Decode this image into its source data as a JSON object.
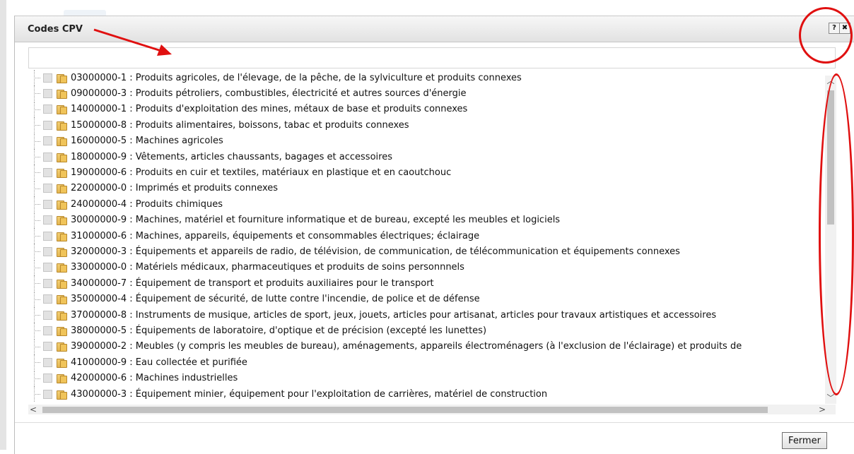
{
  "dialog": {
    "title": "Codes CPV",
    "help_label": "?",
    "close_label": "✖",
    "search": {
      "value": "",
      "placeholder": ""
    },
    "close_button_label": "Fermer"
  },
  "tree": {
    "items": [
      {
        "label": "03000000-1 : Produits agricoles, de l'élevage, de la pêche, de la sylviculture et produits connexes"
      },
      {
        "label": "09000000-3 : Produits pétroliers, combustibles, électricité et autres sources d'énergie"
      },
      {
        "label": "14000000-1 : Produits d'exploitation des mines, métaux de base et produits connexes"
      },
      {
        "label": "15000000-8 : Produits alimentaires, boissons, tabac et produits connexes"
      },
      {
        "label": "16000000-5 : Machines agricoles"
      },
      {
        "label": "18000000-9 : Vêtements, articles chaussants, bagages et accessoires"
      },
      {
        "label": "19000000-6 : Produits en cuir et textiles, matériaux en plastique et en caoutchouc"
      },
      {
        "label": "22000000-0 : Imprimés et produits connexes"
      },
      {
        "label": "24000000-4 : Produits chimiques"
      },
      {
        "label": "30000000-9 : Machines, matériel et fourniture informatique et de bureau, excepté les meubles et logiciels"
      },
      {
        "label": "31000000-6 : Machines, appareils, équipements et consommables électriques; éclairage"
      },
      {
        "label": "32000000-3 : Équipements et appareils de radio, de télévision, de communication, de télécommunication et équipements connexes"
      },
      {
        "label": "33000000-0 : Matériels médicaux, pharmaceutiques et produits de soins personnnels"
      },
      {
        "label": "34000000-7 : Équipement de transport et produits auxiliaires pour le transport"
      },
      {
        "label": "35000000-4 : Équipement de sécurité, de lutte contre l'incendie, de police et de défense"
      },
      {
        "label": "37000000-8 : Instruments de musique, articles de sport, jeux, jouets, articles pour artisanat, articles pour travaux artistiques et accessoires"
      },
      {
        "label": "38000000-5 : Équipements de laboratoire, d'optique et de précision (excepté les lunettes)"
      },
      {
        "label": "39000000-2 : Meubles (y compris les meubles de bureau), aménagements, appareils électroménagers (à l'exclusion de l'éclairage) et produits de"
      },
      {
        "label": "41000000-9 : Eau collectée et purifiée"
      },
      {
        "label": "42000000-6 : Machines industrielles"
      },
      {
        "label": "43000000-3 : Équipement minier, équipement pour l'exploitation de carrières, matériel de construction"
      }
    ]
  },
  "scrollbars": {
    "up_icon": "chevron-up-icon",
    "down_icon": "chevron-down-icon",
    "left_icon": "chevron-left-icon",
    "right_icon": "chevron-right-icon"
  },
  "annotations": {
    "color": "#e01010"
  }
}
